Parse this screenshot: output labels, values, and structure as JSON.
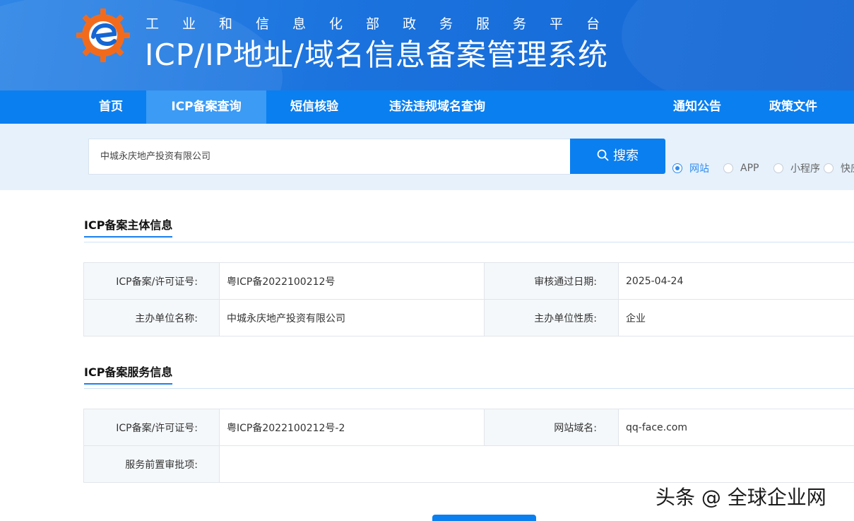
{
  "header": {
    "subtitle": "工业和信息化部政务服务平台",
    "title": "ICP/IP地址/域名信息备案管理系统",
    "colors": {
      "brand_blue": "#1b73de",
      "logo_orange": "#f26b1d"
    }
  },
  "nav": {
    "items": [
      {
        "label": "首页",
        "active": false
      },
      {
        "label": "ICP备案查询",
        "active": true
      },
      {
        "label": "短信核验",
        "active": false
      },
      {
        "label": "违法违规域名查询",
        "active": false
      },
      {
        "label": "通知公告",
        "active": false
      },
      {
        "label": "政策文件",
        "active": false
      }
    ]
  },
  "search": {
    "value": "中城永庆地产投资有限公司",
    "button_label": "搜索",
    "button_icon": "search-icon",
    "types": [
      {
        "label": "网站",
        "checked": true
      },
      {
        "label": "APP",
        "checked": false
      },
      {
        "label": "小程序",
        "checked": false
      },
      {
        "label": "快应",
        "checked": false
      }
    ]
  },
  "subject_info": {
    "title": "ICP备案主体信息",
    "rows": [
      {
        "k1": "ICP备案/许可证号:",
        "v1": "粤ICP备2022100212号",
        "k2": "审核通过日期:",
        "v2": "2025-04-24"
      },
      {
        "k1": "主办单位名称:",
        "v1": "中城永庆地产投资有限公司",
        "k2": "主办单位性质:",
        "v2": "企业"
      }
    ]
  },
  "service_info": {
    "title": "ICP备案服务信息",
    "rows": [
      {
        "k1": "ICP备案/许可证号:",
        "v1": "粤ICP备2022100212号-2",
        "k2": "网站域名:",
        "v2": "qq-face.com"
      },
      {
        "k1": "服务前置审批项:",
        "v1": ""
      }
    ]
  },
  "watermark": "头条 @ 全球企业网"
}
